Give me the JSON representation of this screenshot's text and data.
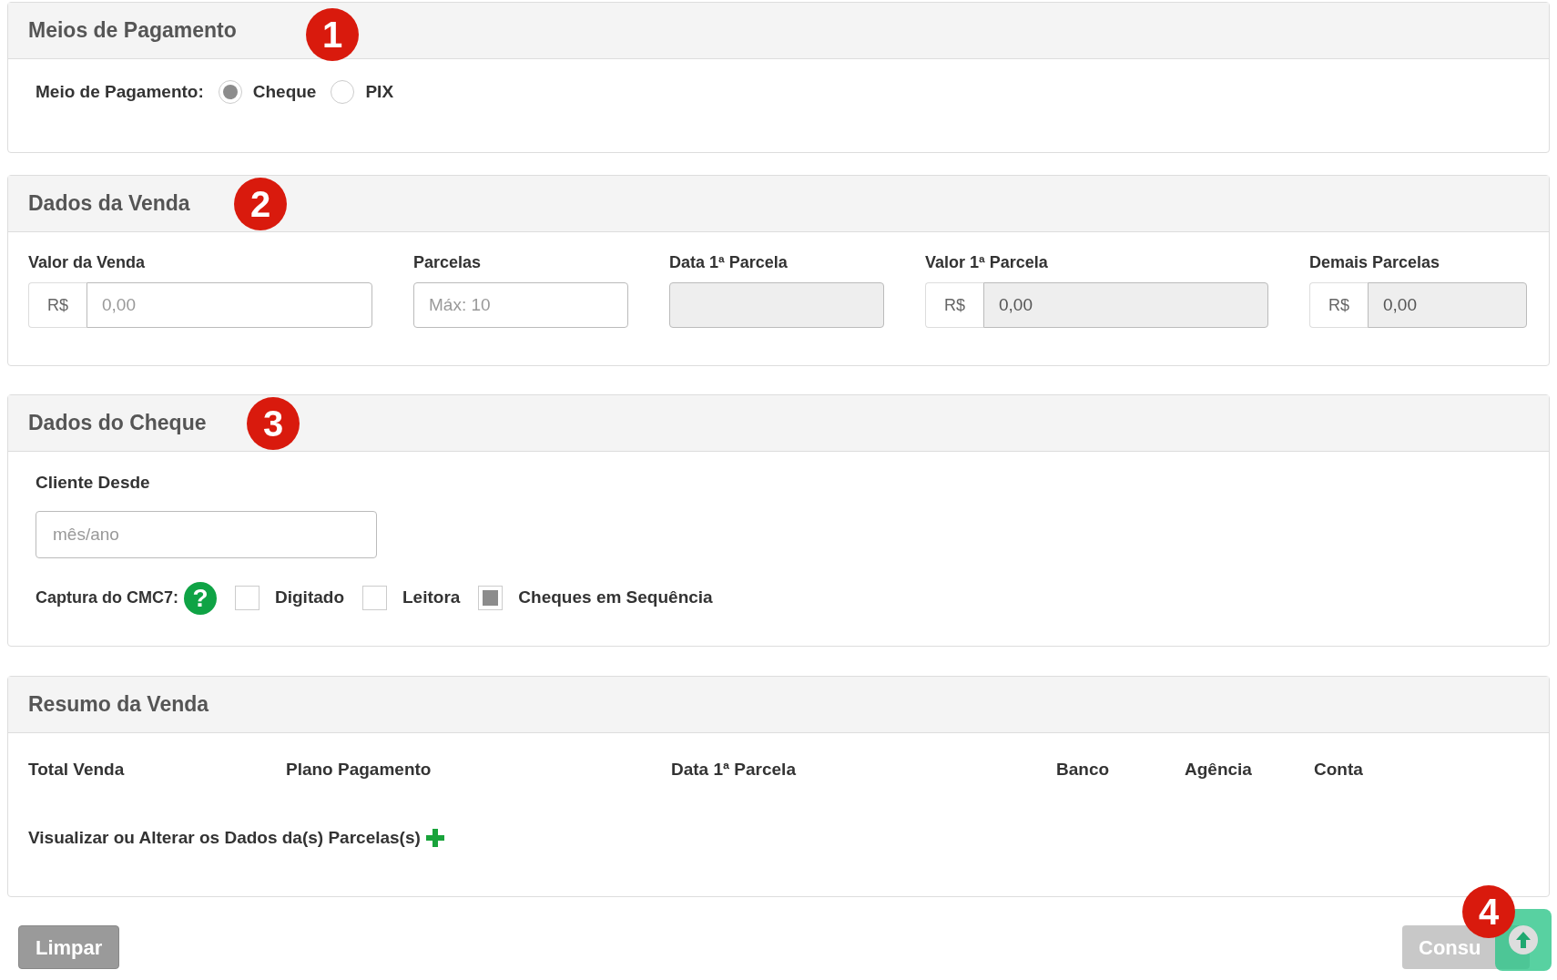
{
  "payment_section": {
    "title": "Meios de Pagamento",
    "marker": "1",
    "label": "Meio de Pagamento:",
    "options": [
      {
        "label": "Cheque",
        "selected": true
      },
      {
        "label": "PIX",
        "selected": false
      }
    ]
  },
  "sale_section": {
    "title": "Dados da Venda",
    "marker": "2",
    "fields": [
      {
        "label": "Valor da Venda",
        "prefix": "R$",
        "placeholder": "0,00",
        "disabled": false
      },
      {
        "label": "Parcelas",
        "placeholder": "Máx: 10",
        "disabled": false
      },
      {
        "label": "Data 1ª Parcela",
        "disabled": true
      },
      {
        "label": "Valor 1ª Parcela",
        "prefix": "R$",
        "value": "0,00",
        "disabled": true
      },
      {
        "label": "Demais Parcelas",
        "prefix": "R$",
        "value": "0,00",
        "disabled": true
      }
    ]
  },
  "cheque_section": {
    "title": "Dados do Cheque",
    "marker": "3",
    "client_since": {
      "label": "Cliente Desde",
      "placeholder": "mês/ano"
    },
    "capture_label": "Captura do CMC7:",
    "help_icon": "?",
    "checkboxes": [
      {
        "label": "Digitado",
        "checked": false
      },
      {
        "label": "Leitora",
        "checked": false
      },
      {
        "label": "Cheques em Sequência",
        "checked": true
      }
    ]
  },
  "summary_section": {
    "title": "Resumo da Venda",
    "columns": [
      "Total Venda",
      "Plano Pagamento",
      "Data 1ª Parcela",
      "Banco",
      "Agência",
      "Conta"
    ],
    "details_link": "Visualizar ou Alterar os Dados da(s) Parcelas(s)"
  },
  "buttons": {
    "clear": "Limpar",
    "submit": "Consu",
    "marker": "4"
  }
}
